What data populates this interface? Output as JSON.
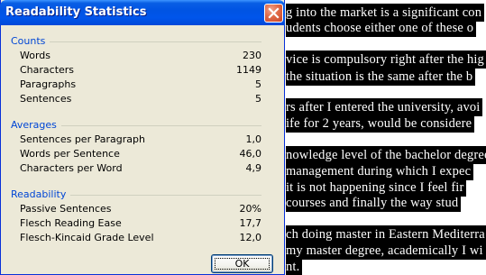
{
  "dialog": {
    "title": "Readability Statistics",
    "ok_label": "OK",
    "sections": {
      "counts": {
        "heading": "Counts",
        "rows": [
          {
            "label": "Words",
            "value": "230"
          },
          {
            "label": "Characters",
            "value": "1149"
          },
          {
            "label": "Paragraphs",
            "value": "5"
          },
          {
            "label": "Sentences",
            "value": "5"
          }
        ]
      },
      "averages": {
        "heading": "Averages",
        "rows": [
          {
            "label": "Sentences per Paragraph",
            "value": "1,0"
          },
          {
            "label": "Words per Sentence",
            "value": "46,0"
          },
          {
            "label": "Characters per Word",
            "value": "4,9"
          }
        ]
      },
      "readability": {
        "heading": "Readability",
        "rows": [
          {
            "label": "Passive Sentences",
            "value": "20%"
          },
          {
            "label": "Flesch Reading Ease",
            "value": "17,7"
          },
          {
            "label": "Flesch-Kincaid Grade Level",
            "value": "12,0"
          }
        ]
      }
    }
  },
  "document": {
    "lines": [
      {
        "text": "g into the market is a significant con",
        "selected": true
      },
      {
        "text": "udents choose either one of these o",
        "selected": true
      },
      {
        "text": "vice is compulsory right after the hig",
        "selected": true
      },
      {
        "text": "the situation is the same after the b",
        "selected": true
      },
      {
        "text": "rs after I entered the university, avoi",
        "selected": true
      },
      {
        "text": "ife for 2 years, would be considere",
        "selected": true
      },
      {
        "text": "nowledge level of the bachelor degree",
        "selected": true
      },
      {
        "text": "management during which I expec",
        "selected": true
      },
      {
        "text": "it is not happening since I feel fir",
        "selected": true
      },
      {
        "text": "courses and finally the way stud",
        "selected": true
      },
      {
        "text": "ch doing master in Eastern Mediterra",
        "selected": true
      },
      {
        "text": "my master degree, academically I wi",
        "selected": true
      },
      {
        "text": "nt.",
        "selected": true
      }
    ]
  },
  "colors": {
    "titlebar": "#0054e3",
    "dialog_bg": "#ece9d8",
    "section_heading": "#0046d5",
    "selection_bg": "#000000",
    "selection_text": "#ffffff"
  },
  "icons": {
    "close": "close-icon"
  }
}
